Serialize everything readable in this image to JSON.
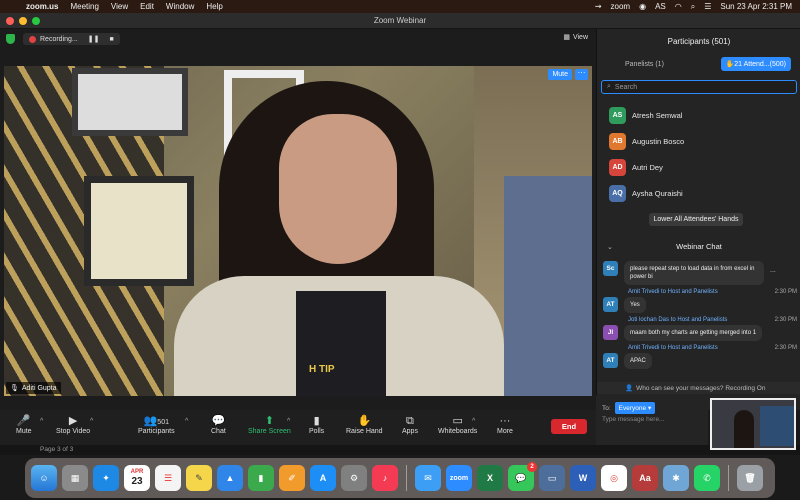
{
  "menubar": {
    "app": "zoom.us",
    "items": [
      "Meeting",
      "View",
      "Edit",
      "Window",
      "Help"
    ],
    "status_zoom": "zoom",
    "status_as": "AS",
    "datetime": "Sun 23 Apr  2:31 PM"
  },
  "window": {
    "title": "Zoom Webinar"
  },
  "video": {
    "recording_label": "Recording...",
    "view_label": "View",
    "mute_label": "Mute",
    "more_label": "···",
    "speaker_name": "Aditi Gupta",
    "shirt_text": "H TIP"
  },
  "toolbar": {
    "mute": "Mute",
    "stop_video": "Stop Video",
    "participants": "Participants",
    "participants_count": "501",
    "chat": "Chat",
    "share_screen": "Share Screen",
    "polls": "Polls",
    "raise_hand": "Raise Hand",
    "apps": "Apps",
    "whiteboards": "Whiteboards",
    "more": "More",
    "end": "End"
  },
  "page_indicator": "Page 3 of 3",
  "participants": {
    "title": "Participants (501)",
    "tab_panelists": "Panelists (1)",
    "tab_attendees": "Attend...(500)",
    "tab_attendees_prefix": "✋21",
    "search_placeholder": "Search",
    "attendees": [
      {
        "initials": "AS",
        "name": "Atresh Semwal",
        "color": "#2f9b5c"
      },
      {
        "initials": "AB",
        "name": "Augustin Bosco",
        "color": "#e0782f"
      },
      {
        "initials": "AD",
        "name": "Autri Dey",
        "color": "#d6453b"
      },
      {
        "initials": "AQ",
        "name": "Aysha Quraishi",
        "color": "#4a6fa8"
      }
    ],
    "lower_hands": "Lower All Attendees' Hands"
  },
  "chat": {
    "title": "Webinar Chat",
    "messages": [
      {
        "initials": "Sc",
        "color": "#2f7fb8",
        "sender": "",
        "time": "",
        "text": "please repeat step to load data in from excel in power bi"
      },
      {
        "initials": "AT",
        "color": "#2f7fb8",
        "sender": "Amit Trivedi to Host and Panelists",
        "time": "2:30 PM",
        "text": "Yes"
      },
      {
        "initials": "JI",
        "color": "#8a4fb0",
        "sender": "Joti lochan Das to Host and Panelists",
        "time": "2:30 PM",
        "text": "maam both my charts are getting merged into 1"
      },
      {
        "initials": "AT",
        "color": "#2f7fb8",
        "sender": "Amit Trivedi to Host and Panelists",
        "time": "2:30 PM",
        "text": "APAC"
      }
    ],
    "more_dots": "...",
    "who_can_see": "Who can see your messages? Recording On",
    "to_label": "To:",
    "to_value": "Everyone",
    "type_placeholder": "Type message here..."
  },
  "dock": {
    "calendar_month": "APR",
    "calendar_day": "23",
    "zoom_label": "zoom",
    "messages_badge": "2"
  }
}
